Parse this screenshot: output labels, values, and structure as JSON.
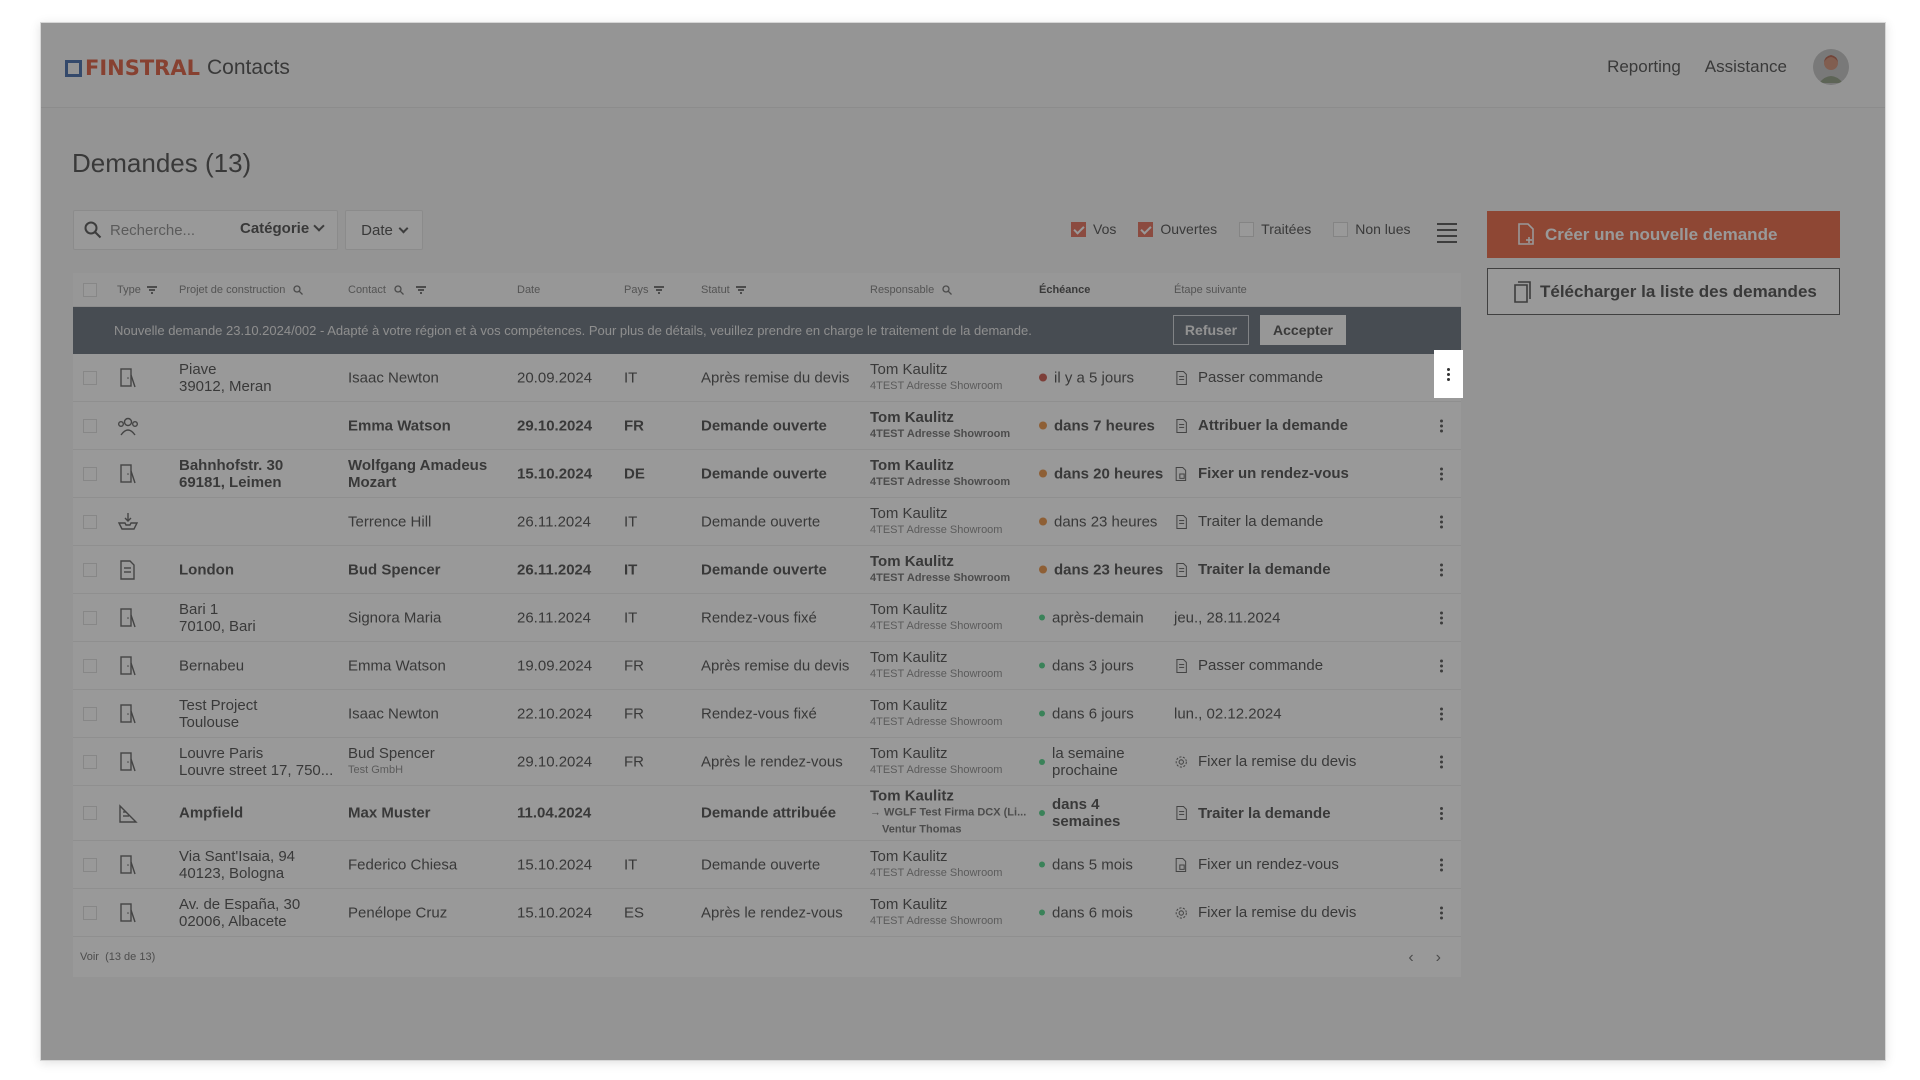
{
  "header": {
    "brand": "FINSTRAL",
    "app_name": "Contacts",
    "nav": [
      "Reporting",
      "Assistance"
    ]
  },
  "page": {
    "title": "Demandes (13)"
  },
  "filters": {
    "search_placeholder": "Recherche...",
    "category_label": "Catégorie",
    "date_label": "Date",
    "checkboxes": [
      {
        "label": "Vos",
        "checked": true
      },
      {
        "label": "Ouvertes",
        "checked": true
      },
      {
        "label": "Traitées",
        "checked": false
      },
      {
        "label": "Non lues",
        "checked": false
      }
    ]
  },
  "actions": {
    "create_label": "Créer une nouvelle demande",
    "download_label": "Télécharger la liste des demandes"
  },
  "table": {
    "columns": {
      "type": "Type",
      "project": "Projet de construction",
      "contact": "Contact",
      "date": "Date",
      "country": "Pays",
      "status": "Statut",
      "responsible": "Responsable",
      "due": "Échéance",
      "next": "Étape suivante"
    },
    "banner": {
      "text": "Nouvelle demande 23.10.2024/002 - Adapté à votre région et à vos compétences. Pour plus de détails, veuillez prendre en charge le traitement de la demande.",
      "refuse_label": "Refuser",
      "accept_label": "Accepter"
    },
    "rows": [
      {
        "project1": "Piave",
        "project2": "39012, Meran",
        "contact": "Isaac Newton",
        "contact_sub": "",
        "date": "20.09.2024",
        "country": "IT",
        "status": "Après remise du devis",
        "resp": "Tom Kaulitz",
        "resp_sub": "4TEST Adresse Showroom",
        "resp_sub2": "",
        "due": "il y a 5 jours",
        "due_color": "red",
        "next": "Passer commande"
      },
      {
        "project1": "",
        "project2": "",
        "contact": "Emma Watson",
        "contact_sub": "",
        "date": "29.10.2024",
        "country": "FR",
        "status": "Demande ouverte",
        "resp": "Tom Kaulitz",
        "resp_sub": "4TEST Adresse Showroom",
        "resp_sub2": "",
        "due": "dans 7 heures",
        "due_color": "orange",
        "next": "Attribuer la demande"
      },
      {
        "project1": "Bahnhofstr. 30",
        "project2": "69181, Leimen",
        "contact": "Wolfgang Amadeus Mozart",
        "contact_sub": "",
        "date": "15.10.2024",
        "country": "DE",
        "status": "Demande ouverte",
        "resp": "Tom Kaulitz",
        "resp_sub": "4TEST Adresse Showroom",
        "resp_sub2": "",
        "due": "dans 20 heures",
        "due_color": "orange",
        "next": "Fixer un rendez-vous"
      },
      {
        "project1": "",
        "project2": "",
        "contact": "Terrence Hill",
        "contact_sub": "",
        "date": "26.11.2024",
        "country": "IT",
        "status": "Demande ouverte",
        "resp": "Tom Kaulitz",
        "resp_sub": "4TEST Adresse Showroom",
        "resp_sub2": "",
        "due": "dans 23 heures",
        "due_color": "orange",
        "next": "Traiter la demande"
      },
      {
        "project1": "London",
        "project2": "",
        "contact": "Bud Spencer",
        "contact_sub": "",
        "date": "26.11.2024",
        "country": "IT",
        "status": "Demande ouverte",
        "resp": "Tom Kaulitz",
        "resp_sub": "4TEST Adresse Showroom",
        "resp_sub2": "",
        "due": "dans 23 heures",
        "due_color": "orange",
        "next": "Traiter la demande"
      },
      {
        "project1": "Bari 1",
        "project2": "70100, Bari",
        "contact": "Signora Maria",
        "contact_sub": "",
        "date": "26.11.2024",
        "country": "IT",
        "status": "Rendez-vous fixé",
        "resp": "Tom Kaulitz",
        "resp_sub": "4TEST Adresse Showroom",
        "resp_sub2": "",
        "due": "après-demain",
        "due_color": "green",
        "next": "jeu., 28.11.2024"
      },
      {
        "project1": "Bernabeu",
        "project2": "",
        "contact": "Emma Watson",
        "contact_sub": "",
        "date": "19.09.2024",
        "country": "FR",
        "status": "Après remise du devis",
        "resp": "Tom Kaulitz",
        "resp_sub": "4TEST Adresse Showroom",
        "resp_sub2": "",
        "due": "dans 3 jours",
        "due_color": "green",
        "next": "Passer commande"
      },
      {
        "project1": "Test Project",
        "project2": "Toulouse",
        "contact": "Isaac Newton",
        "contact_sub": "",
        "date": "22.10.2024",
        "country": "FR",
        "status": "Rendez-vous fixé",
        "resp": "Tom Kaulitz",
        "resp_sub": "4TEST Adresse Showroom",
        "resp_sub2": "",
        "due": "dans 6 jours",
        "due_color": "green",
        "next": "lun., 02.12.2024"
      },
      {
        "project1": "Louvre Paris",
        "project2": "Louvre street 17, 750...",
        "contact": "Bud Spencer",
        "contact_sub": "Test GmbH",
        "date": "29.10.2024",
        "country": "FR",
        "status": "Après le rendez-vous",
        "resp": "Tom Kaulitz",
        "resp_sub": "4TEST Adresse Showroom",
        "resp_sub2": "",
        "due": "la semaine prochaine",
        "due_color": "green",
        "next": "Fixer la remise du devis"
      },
      {
        "project1": "Ampfield",
        "project2": "",
        "contact": "Max Muster",
        "contact_sub": "",
        "date": "11.04.2024",
        "country": "",
        "status": "Demande attribuée",
        "resp": "Tom Kaulitz",
        "resp_sub": "→ WGLF Test Firma DCX (Li...",
        "resp_sub2": "Ventur Thomas",
        "due": "dans 4 semaines",
        "due_color": "green",
        "next": "Traiter la demande"
      },
      {
        "project1": "Via Sant'Isaia, 94",
        "project2": "40123, Bologna",
        "contact": "Federico Chiesa",
        "contact_sub": "",
        "date": "15.10.2024",
        "country": "IT",
        "status": "Demande ouverte",
        "resp": "Tom Kaulitz",
        "resp_sub": "4TEST Adresse Showroom",
        "resp_sub2": "",
        "due": "dans 5 mois",
        "due_color": "green",
        "next": "Fixer un rendez-vous"
      },
      {
        "project1": "Av. de España, 30",
        "project2": "02006, Albacete",
        "contact": "Penélope Cruz",
        "contact_sub": "",
        "date": "15.10.2024",
        "country": "ES",
        "status": "Après le rendez-vous",
        "resp": "Tom Kaulitz",
        "resp_sub": "4TEST Adresse Showroom",
        "resp_sub2": "",
        "due": "dans 6 mois",
        "due_color": "green",
        "next": "Fixer la remise du devis"
      }
    ],
    "footer": {
      "view_label": "Voir",
      "count": "(13 de 13)"
    }
  }
}
